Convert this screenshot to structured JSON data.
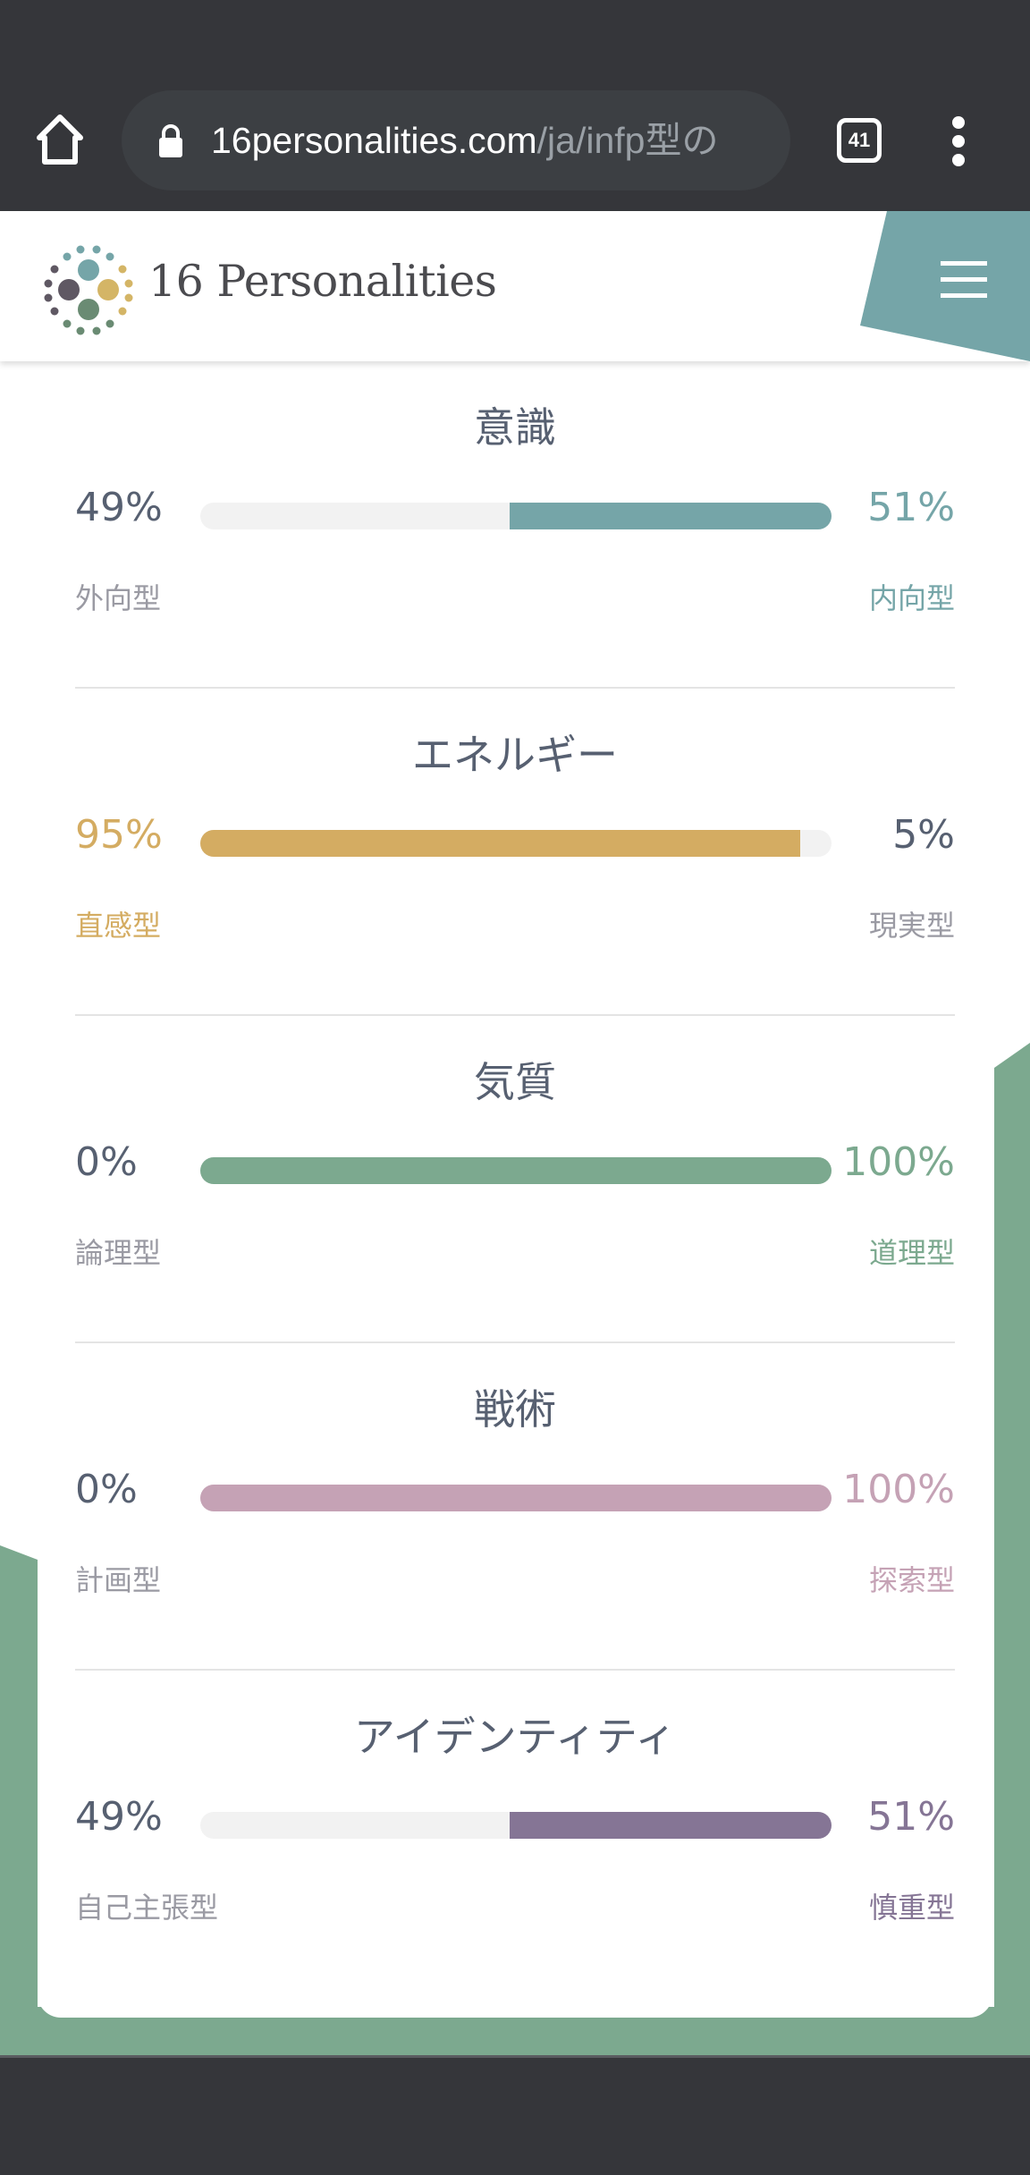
{
  "browser": {
    "url_domain": "16personalities.com",
    "url_path": "/ja/infp型の",
    "tab_count": "41"
  },
  "header": {
    "brand": "16 Personalities"
  },
  "colors": {
    "mind": "#75a5a8",
    "energy": "#d4ac62",
    "nature": "#7ca98f",
    "tactics": "#c5a2b5",
    "identity": "#857595",
    "text_dark": "#576071",
    "text_muted": "#9a9aa3",
    "track": "#f2f2f2"
  },
  "traits": [
    {
      "title": "意識",
      "left_pct": "49%",
      "right_pct": "51%",
      "left_label": "外向型",
      "right_label": "内向型",
      "dominant": "right",
      "fill_percent": 51,
      "color": "#75a5a8"
    },
    {
      "title": "エネルギー",
      "left_pct": "95%",
      "right_pct": "5%",
      "left_label": "直感型",
      "right_label": "現実型",
      "dominant": "left",
      "fill_percent": 95,
      "color": "#d4ac62"
    },
    {
      "title": "気質",
      "left_pct": "0%",
      "right_pct": "100%",
      "left_label": "論理型",
      "right_label": "道理型",
      "dominant": "right",
      "fill_percent": 100,
      "color": "#7ca98f"
    },
    {
      "title": "戦術",
      "left_pct": "0%",
      "right_pct": "100%",
      "left_label": "計画型",
      "right_label": "探索型",
      "dominant": "right",
      "fill_percent": 100,
      "color": "#c5a2b5"
    },
    {
      "title": "アイデンティティ",
      "left_pct": "49%",
      "right_pct": "51%",
      "left_label": "自己主張型",
      "right_label": "慎重型",
      "dominant": "right",
      "fill_percent": 51,
      "color": "#857595"
    }
  ]
}
